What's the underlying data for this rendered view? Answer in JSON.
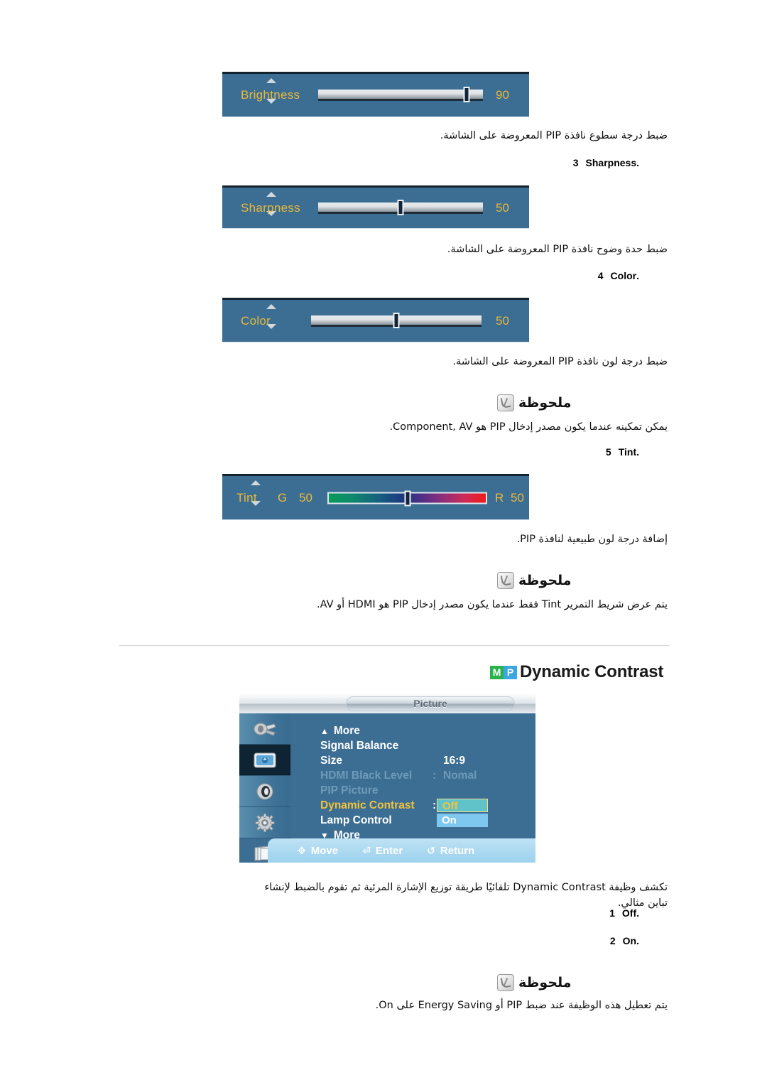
{
  "sliders": [
    {
      "name": "Brightness",
      "label": "Brightness",
      "value": "90",
      "percent": 90,
      "up_icon": "chevron-up-icon",
      "down_icon": "chevron-down-icon"
    },
    {
      "name": "Sharpness",
      "label": "Sharpness",
      "value": "50",
      "percent": 50,
      "up_icon": "chevron-up-icon",
      "down_icon": "chevron-down-icon"
    },
    {
      "name": "Color",
      "label": "Color",
      "value": "50",
      "percent": 50,
      "up_icon": "chevron-up-icon",
      "down_icon": "chevron-down-icon"
    }
  ],
  "tint_slider": {
    "label": "Tint",
    "green_letter": "G",
    "green_value": "50",
    "red_letter": "R",
    "red_value": "50",
    "percent": 50
  },
  "descriptions": {
    "brightness": "ضبط درجة سطوع نافذة PIP المعروضة على الشاشة.",
    "sharpness": "ضبط حدة وضوح نافذة PIP المعروضة على الشاشة.",
    "color": "ضبط درجة لون نافذة PIP المعروضة على الشاشة.",
    "tint": "إضافة درجة لون طبيعية لنافذة PIP."
  },
  "list_items": [
    {
      "index": ".3",
      "name": "Sharpness"
    },
    {
      "index": ".4",
      "name": "Color"
    },
    {
      "index": ".5",
      "name": "Tint"
    }
  ],
  "notes": [
    {
      "title": "ملحوظة",
      "icon": "note-pen-icon",
      "text": "يمكن تمكينه عندما يكون مصدر إدخال PIP هو Component, AV."
    },
    {
      "title": "ملحوظة",
      "icon": "note-pen-icon",
      "text": "يتم عرض شريط التمرير Tint فقط عندما يكون مصدر إدخال PIP هو HDMI أو AV."
    },
    {
      "title": "ملحوظة",
      "icon": "note-pen-icon",
      "text": "يتم تعطيل هذه الوظيفة عند ضبط PIP أو Energy Saving على On."
    }
  ],
  "section": {
    "badge_m": "M",
    "badge_p": "P",
    "title": "Dynamic Contrast",
    "badge_m_color": "#2bb24c",
    "badge_p_color": "#3ba7e0"
  },
  "osd_menu": {
    "title": "Picture",
    "sidebar_icons": [
      "input-source-icon",
      "picture-icon",
      "sound-speaker-icon",
      "setup-gear-icon",
      "multi-display-icon"
    ],
    "rows": [
      {
        "label": "More",
        "caret": "▲",
        "value": "",
        "state": "normal",
        "has_caret": true
      },
      {
        "label": "Signal Balance",
        "caret": "",
        "value": "",
        "state": "normal",
        "has_caret": false
      },
      {
        "label": "Size",
        "caret": "",
        "value": "16:9",
        "state": "normal",
        "has_caret": false
      },
      {
        "label": "HDMI Black Level",
        "caret": "",
        "value": "Nomal",
        "colon": ":",
        "state": "dim",
        "has_caret": false
      },
      {
        "label": "PIP Picture",
        "caret": "",
        "value": "",
        "state": "dim",
        "has_caret": false
      },
      {
        "label": "Dynamic Contrast",
        "caret": "",
        "value": "",
        "colon": ":",
        "state": "selected",
        "has_caret": false
      },
      {
        "label": "Lamp Control",
        "caret": "",
        "value": "",
        "state": "normal",
        "has_caret": false
      },
      {
        "label": "More",
        "caret": "▼",
        "value": "",
        "state": "normal",
        "has_caret": true
      }
    ],
    "dropdown": {
      "option_off": "Off",
      "option_on": "On",
      "selected": "Off"
    },
    "footer": [
      {
        "icon": "move-dpad-icon",
        "label": "Move"
      },
      {
        "icon": "enter-key-icon",
        "label": "Enter"
      },
      {
        "icon": "return-arrow-icon",
        "label": "Return"
      }
    ]
  },
  "dynamic_contrast": {
    "description": "تكشف وظيفة Dynamic Contrast تلقائيًا طريقة توزيع الإشارة المرئية ثم تقوم بالضبط لإنشاء تباين مثالي.",
    "options": [
      {
        "index": ".1",
        "name": "Off"
      },
      {
        "index": ".2",
        "name": "On"
      }
    ]
  }
}
